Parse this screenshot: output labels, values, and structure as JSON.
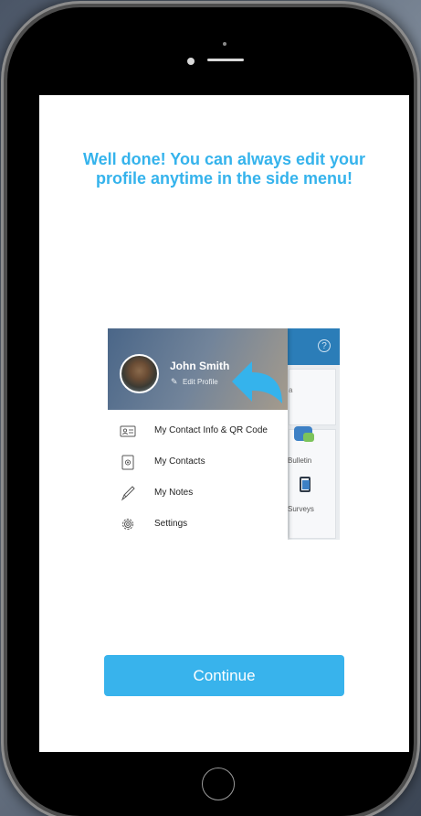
{
  "onboarding": {
    "headline": "Well done! You can always edit your profile anytime in the side menu!",
    "continue_label": "Continue"
  },
  "preview": {
    "user_name": "John Smith",
    "edit_profile_label": "Edit Profile",
    "menu_items": [
      {
        "label": "My Contact Info & QR Code",
        "icon": "id-card-icon"
      },
      {
        "label": "My Contacts",
        "icon": "contacts-icon"
      },
      {
        "label": "My Notes",
        "icon": "pencil-icon"
      },
      {
        "label": "Settings",
        "icon": "gear-icon"
      }
    ],
    "background_tiles": [
      "Bulletin",
      "Surveys"
    ],
    "background_partial_text": "a"
  },
  "colors": {
    "accent": "#38b3ec",
    "headline": "#35b3ec",
    "app_header": "#2b7db8"
  }
}
